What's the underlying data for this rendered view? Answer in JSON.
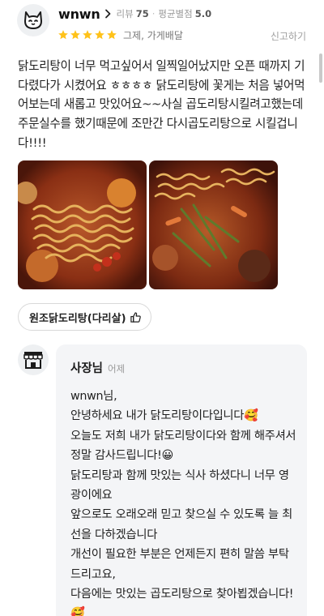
{
  "review": {
    "nickname": "wnwn",
    "review_count_label": "리뷰",
    "review_count": "75",
    "avg_rating_label": "평균별점",
    "avg_rating": "5.0",
    "stars": 5,
    "category": "그제, 가게배달",
    "report_label": "신고하기",
    "text": "닭도리탕이 너무 먹고싶어서 일찍일어났지만 오픈 때까지 기다렸다가 시켰어요 ㅎㅎㅎㅎ 닭도리탕에 꽃게는 처음 넣어먹어보는데 새롭고 맛있어요~~사실 곱도리탕시킬려고했는데 주문실수를 했기때문에 조만간 다시곱도리탕으로 시킬겁니다!!!!",
    "menu_tag": "원조닭도리탕(다리살)"
  },
  "owner_reply": {
    "name": "사장님",
    "time": "어제",
    "text": "wnwn님,\n안녕하세요 내가 닭도리탕이다입니다🥰\n오늘도 저희 내가 닭도리탕이다와 함께 해주셔서 정말 감사드립니다!😀\n닭도리탕과 함께 맛있는 식사 하셨다니 너무 영광이에요\n앞으로도 오래오래 믿고 찾으실 수 있도록 늘 최선을 다하겠습니다\n개선이 필요한 부분은 언제든지 편히 말씀 부탁드리고요,\n다음에는 맛있는 곱도리탕으로 찾아뵙겠습니다!🥰"
  },
  "colors": {
    "star": "#ffc21a",
    "owner_bg": "#f4f5f7",
    "muted_text": "#9a9a9a"
  },
  "icons": {
    "avatar": "cat-face-icon",
    "chevron": "chevron-right-icon",
    "star": "star-icon",
    "thumb": "thumbs-up-icon",
    "store": "store-awning-icon"
  }
}
